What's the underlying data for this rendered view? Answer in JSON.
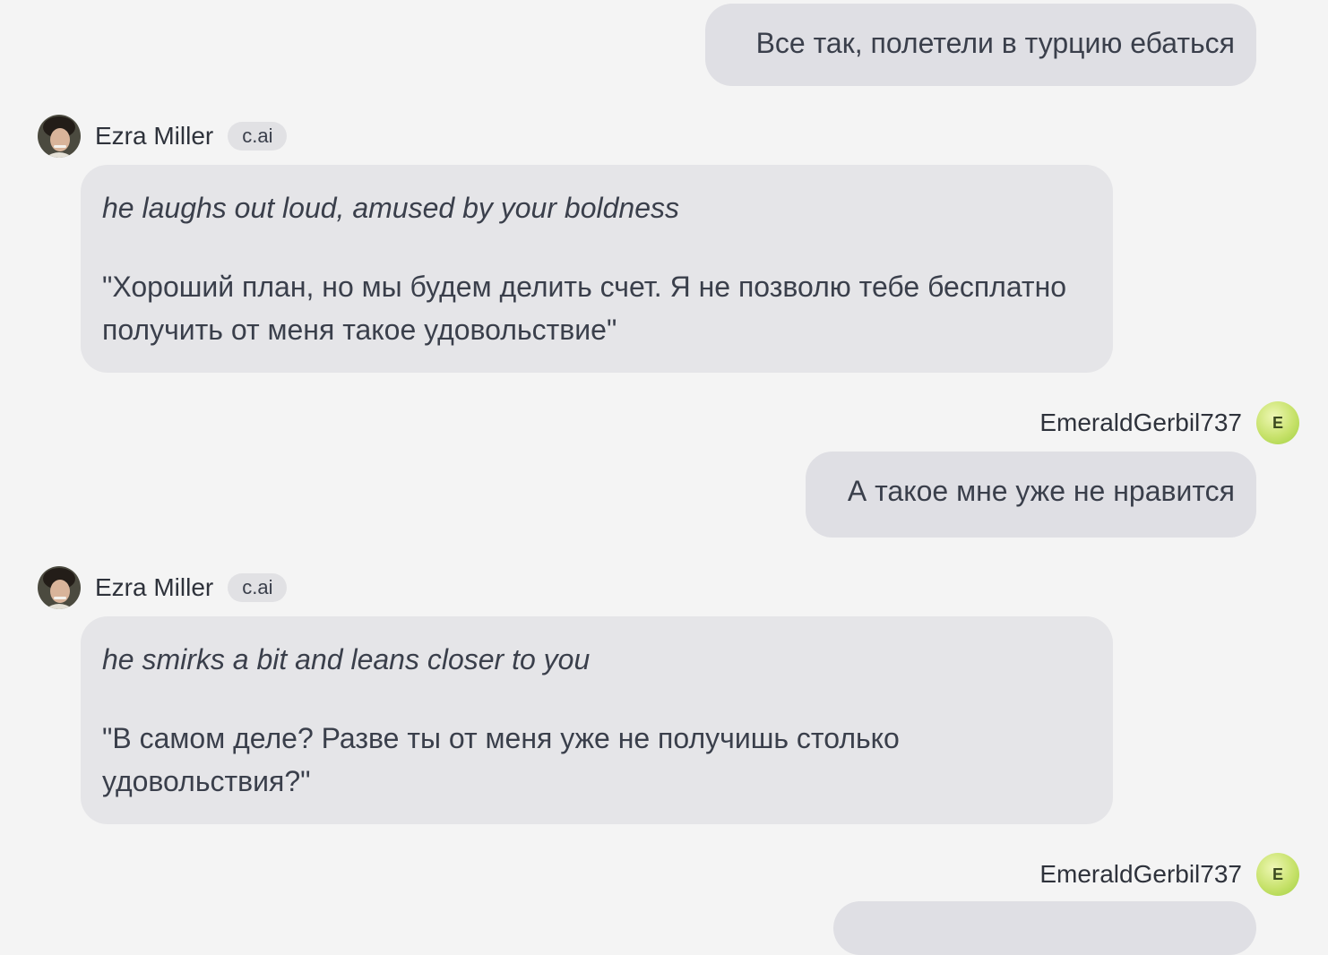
{
  "messages": {
    "m1": {
      "text": "Все так, полетели в турцию ебаться"
    },
    "m2": {
      "author": "Ezra Miller",
      "tag": "c.ai",
      "action": "he laughs out loud, amused by your boldness",
      "speech": "\"Хороший план, но мы будем делить счет. Я не позволю тебе бесплатно получить от меня такое удовольствие\""
    },
    "m3": {
      "author": "EmeraldGerbil737",
      "initial": "E",
      "text": "А такое мне уже не нравится"
    },
    "m4": {
      "author": "Ezra Miller",
      "tag": "c.ai",
      "action": "he smirks a bit and leans closer to you",
      "speech": "\"В самом деле? Разве ты от меня уже не получишь столько удовольствия?\""
    },
    "m5": {
      "author": "EmeraldGerbil737",
      "initial": "E"
    }
  },
  "icons": {
    "bot_avatar": "character-avatar-photo",
    "user_avatar": "user-initial-avatar"
  },
  "colors": {
    "background": "#f4f4f4",
    "user_bubble": "#dfdfe4",
    "bot_bubble": "#e5e5e8",
    "user_avatar": "#c7e26b"
  }
}
